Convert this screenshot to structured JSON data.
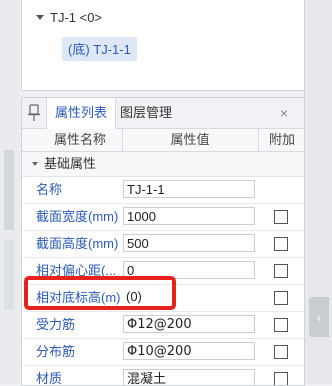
{
  "tree": {
    "root_label": "TJ-1 <0>",
    "child_label": "(底) TJ-1-1"
  },
  "tabs": {
    "active": "属性列表",
    "inactive": "图层管理",
    "close": "×"
  },
  "grid": {
    "col_name": "属性名称",
    "col_value": "属性值",
    "col_append": "附加"
  },
  "group": {
    "label": "基础属性"
  },
  "properties": [
    {
      "name": "名称",
      "value": "TJ-1-1",
      "boxed": true,
      "has_check": false
    },
    {
      "name": "截面宽度(mm)",
      "value": "1000",
      "boxed": true,
      "has_check": true
    },
    {
      "name": "截面高度(mm)",
      "value": "500",
      "boxed": true,
      "has_check": true
    },
    {
      "name": "相对偏心距(...",
      "value": "0",
      "boxed": true,
      "has_check": true
    },
    {
      "name": "相对底标高(m)",
      "value": "(0)",
      "boxed": false,
      "has_check": true
    },
    {
      "name": "受力筋",
      "value": "Φ12@200",
      "boxed": true,
      "has_check": true
    },
    {
      "name": "分布筋",
      "value": "Φ10@200",
      "boxed": true,
      "has_check": true
    },
    {
      "name": "材质",
      "value": "混凝土",
      "boxed": true,
      "has_check": true
    }
  ],
  "colors": {
    "accent": "#2b5bb6",
    "highlight": "#e5231c"
  }
}
